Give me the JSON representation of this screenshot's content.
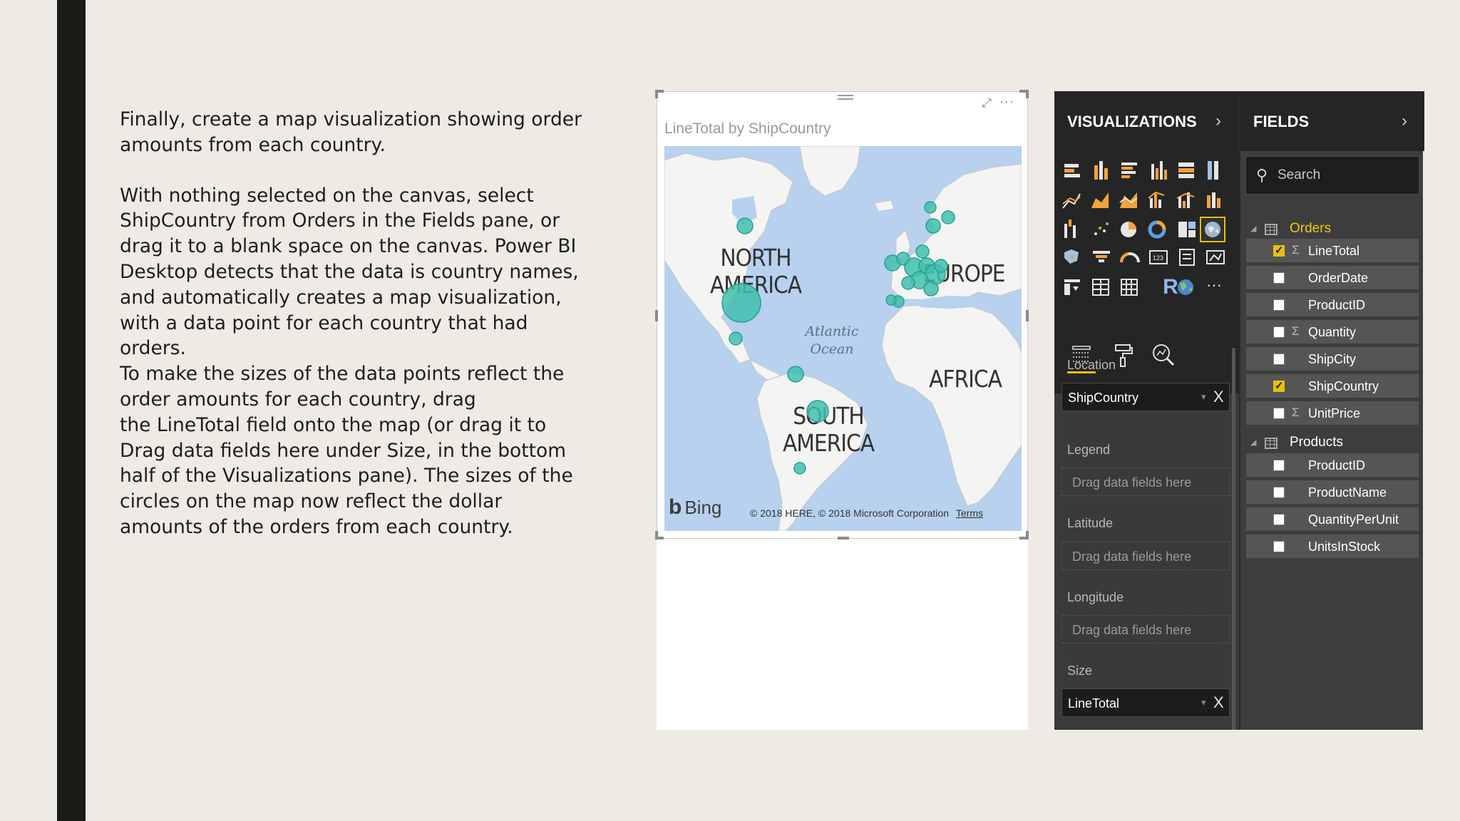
{
  "slide": {
    "paragraph1": "Finally, create a map visualization showing order amounts from each country.",
    "paragraph2": "With nothing selected on the canvas, select ShipCountry from Orders in the Fields pane, or drag it  to a blank space on the canvas. Power BI Desktop detects that the data is country names, and  automatically creates a map visualization, with a data point for each country that had orders.",
    "paragraph3": "To make the sizes of the data points reflect the order amounts for each country, drag\nthe LineTotal field onto the map (or drag it to Drag data fields here under Size, in the bottom half  of the Visualizations pane). The sizes of the circles on the map now reflect the dollar amounts of  the orders from each country."
  },
  "visual": {
    "title": "LineTotal by ShipCountry",
    "focus_icon": "focus-mode-icon",
    "more_icon": "more-options-icon",
    "more_text": "···",
    "map": {
      "labels": {
        "north_america": "NORTH\nAMERICA",
        "europe": "EUROPE",
        "africa": "AFRICA",
        "south_america": "SOUTH\nAMERICA",
        "ocean": "Atlantic\nOcean"
      },
      "bing": "Bing",
      "copyright": "© 2018 HERE, © 2018 Microsoft Corporation",
      "terms": "Terms",
      "bubble_color": "#3fbfae"
    }
  },
  "visualizations_pane": {
    "title": "VISUALIZATIONS",
    "chevron": "›",
    "selected_icon": "filled-map-icon",
    "r_icon": "R",
    "more_visuals": "···",
    "tabs": [
      {
        "name": "fields-tab-icon",
        "glyph": "☰"
      },
      {
        "name": "format-tab-icon",
        "glyph": "⚲"
      },
      {
        "name": "analytics-tab-icon",
        "glyph": "🔍"
      }
    ],
    "wells": {
      "location": {
        "label": "Location",
        "value": "ShipCountry"
      },
      "legend": {
        "label": "Legend",
        "placeholder": "Drag data fields here"
      },
      "latitude": {
        "label": "Latitude",
        "placeholder": "Drag data fields here"
      },
      "longitude": {
        "label": "Longitude",
        "placeholder": "Drag data fields here"
      },
      "size": {
        "label": "Size",
        "value": "LineTotal"
      }
    },
    "remove_glyph": "X",
    "dropdown_glyph": "▾"
  },
  "fields_pane": {
    "title": "FIELDS",
    "chevron": "›",
    "search_placeholder": "Search",
    "tables": [
      {
        "name": "Orders",
        "name_color": "#f2c811",
        "fields": [
          {
            "name": "LineTotal",
            "checked": true,
            "sigma": true
          },
          {
            "name": "OrderDate",
            "checked": false,
            "sigma": false
          },
          {
            "name": "ProductID",
            "checked": false,
            "sigma": false
          },
          {
            "name": "Quantity",
            "checked": false,
            "sigma": true
          },
          {
            "name": "ShipCity",
            "checked": false,
            "sigma": false
          },
          {
            "name": "ShipCountry",
            "checked": true,
            "sigma": false
          },
          {
            "name": "UnitPrice",
            "checked": false,
            "sigma": true
          }
        ]
      },
      {
        "name": "Products",
        "name_color": "#ffffff",
        "fields": [
          {
            "name": "ProductID",
            "checked": false,
            "sigma": false
          },
          {
            "name": "ProductName",
            "checked": false,
            "sigma": false
          },
          {
            "name": "QuantityPerUnit",
            "checked": false,
            "sigma": false
          },
          {
            "name": "UnitsInStock",
            "checked": false,
            "sigma": false
          }
        ]
      }
    ],
    "sigma_glyph": "Σ"
  }
}
